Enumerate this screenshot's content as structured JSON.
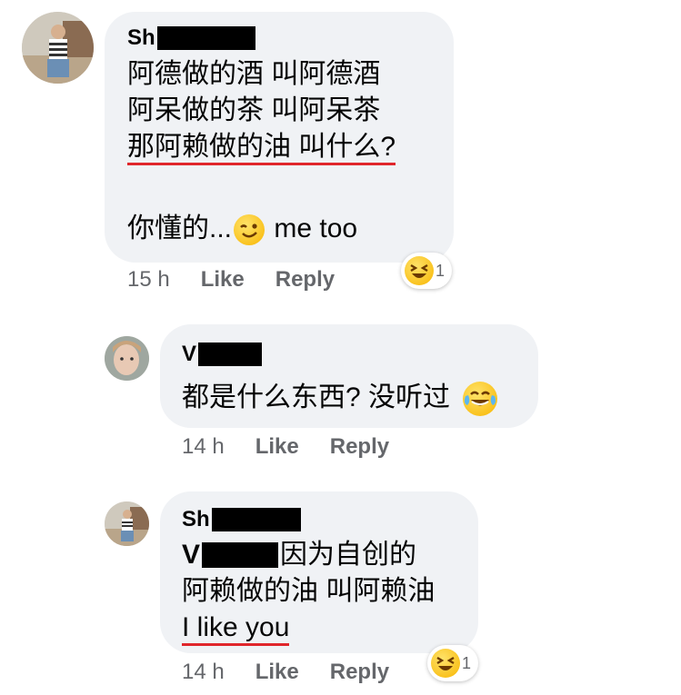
{
  "comments": [
    {
      "author": "Sh",
      "lines": [
        "阿德做的酒 叫阿德酒",
        "阿呆做的茶 叫阿呆茶",
        "那阿赖做的油 叫什么?"
      ],
      "last_line_prefix": "你懂的...",
      "last_line_suffix": " me too",
      "emoji": "winking-face-icon",
      "time": "15 h",
      "like": "Like",
      "reply": "Reply",
      "reaction": {
        "emoji": "laughing-face-icon",
        "count": "1"
      }
    },
    {
      "author": "V",
      "line": "都是什么东西? 没听过",
      "emoji": "tears-of-joy-icon",
      "time": "14 h",
      "like": "Like",
      "reply": "Reply"
    },
    {
      "author": "Sh",
      "mention": "V",
      "line1_suffix": "因为自创的",
      "line2": "阿赖做的油 叫阿赖油",
      "line3": "I like you",
      "time": "14 h",
      "like": "Like",
      "reply": "Reply",
      "reaction": {
        "emoji": "laughing-face-icon",
        "count": "1"
      }
    }
  ],
  "colors": {
    "bubble": "#f0f2f5",
    "meta": "#65676b",
    "underline": "#e0262b",
    "redaction": "#000000"
  }
}
